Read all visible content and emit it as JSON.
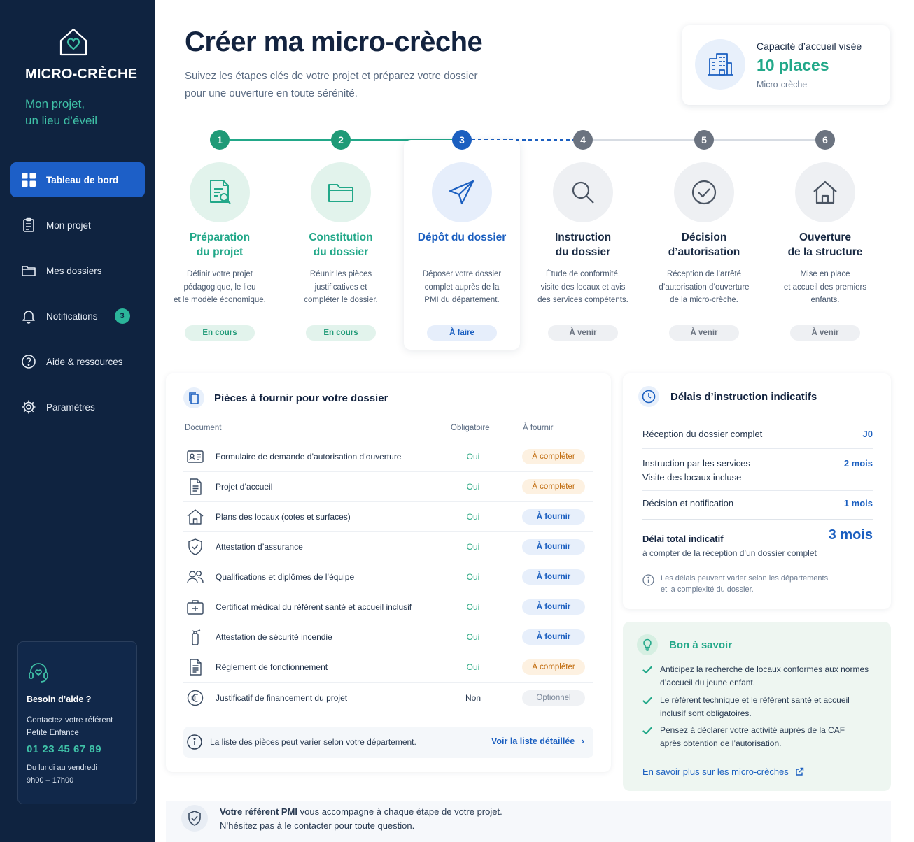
{
  "sidebar": {
    "brand": "MICRO-CRÈCHE",
    "tagline_1": "Mon projet,",
    "tagline_2": "un lieu d’éveil",
    "items": [
      {
        "label": "Tableau de bord",
        "icon": "grid-icon"
      },
      {
        "label": "Mon projet",
        "icon": "clipboard-icon"
      },
      {
        "label": "Mes dossiers",
        "icon": "folder-icon"
      },
      {
        "label": "Notifications",
        "icon": "bell-icon",
        "badge": "3"
      },
      {
        "label": "Aide & ressources",
        "icon": "help-circle-icon"
      },
      {
        "label": "Paramètres",
        "icon": "gear-icon"
      }
    ],
    "help": {
      "title": "Besoin d’aide ?",
      "text": "Contactez votre référent Petite Enfance",
      "phone": "01 23 45 67 89",
      "hours_1": "Du lundi au vendredi",
      "hours_2": "9h00 – 17h00"
    }
  },
  "header": {
    "title": "Créer ma micro-crèche",
    "subtitle_1": "Suivez les étapes clés de votre projet et préparez votre dossier",
    "subtitle_2": "pour une ouverture en toute sérénité."
  },
  "capacity": {
    "label": "Capacité d’accueil visée",
    "value": "10 places",
    "sub": "Micro-crèche"
  },
  "steps": [
    {
      "num": "1",
      "title_1": "Préparation",
      "title_2": "du projet",
      "desc_1": "Définir votre projet",
      "desc_2": "pédagogique, le lieu",
      "desc_3": "et le modèle économique.",
      "status": "En cours",
      "icon": "document-search-icon"
    },
    {
      "num": "2",
      "title_1": "Constitution",
      "title_2": "du dossier",
      "desc_1": "Réunir les pièces",
      "desc_2": "justificatives et",
      "desc_3": "compléter le dossier.",
      "status": "En cours",
      "icon": "folder-icon"
    },
    {
      "num": "3",
      "title_1": "Dépôt du dossier",
      "title_2": "",
      "desc_1": "Déposer votre dossier",
      "desc_2": "complet auprès de la",
      "desc_3": "PMI du département.",
      "status": "À faire",
      "icon": "paper-plane-icon"
    },
    {
      "num": "4",
      "title_1": "Instruction",
      "title_2": "du dossier",
      "desc_1": "Étude de conformité,",
      "desc_2": "visite des locaux et avis",
      "desc_3": "des services compétents.",
      "status": "À venir",
      "icon": "magnifier-icon"
    },
    {
      "num": "5",
      "title_1": "Décision",
      "title_2": "d’autorisation",
      "desc_1": "Réception de l’arrêté",
      "desc_2": "d’autorisation d’ouverture",
      "desc_3": "de la micro-crèche.",
      "status": "À venir",
      "icon": "check-circle-icon"
    },
    {
      "num": "6",
      "title_1": "Ouverture",
      "title_2": "de la structure",
      "desc_1": "Mise en place",
      "desc_2": "et accueil des premiers",
      "desc_3": "enfants.",
      "status": "À venir",
      "icon": "house-icon"
    }
  ],
  "docs": {
    "title": "Pièces à fournir pour votre dossier",
    "col_doc": "Document",
    "col_req": "Obligatoire",
    "col_todo": "À fournir",
    "rows": [
      {
        "name": "Formulaire de demande d’autorisation d’ouverture",
        "req": "Oui",
        "status": "À compléter",
        "icon": "id-card-icon"
      },
      {
        "name": "Projet d’accueil",
        "req": "Oui",
        "status": "À compléter",
        "icon": "document-icon"
      },
      {
        "name": "Plans des locaux (cotes et surfaces)",
        "req": "Oui",
        "status": "À fournir",
        "icon": "house-icon"
      },
      {
        "name": "Attestation d’assurance",
        "req": "Oui",
        "status": "À fournir",
        "icon": "shield-check-icon"
      },
      {
        "name": "Qualifications et diplômes de l’équipe",
        "req": "Oui",
        "status": "À fournir",
        "icon": "users-icon"
      },
      {
        "name": "Certificat médical du référent santé et accueil inclusif",
        "req": "Oui",
        "status": "À fournir",
        "icon": "medical-kit-icon"
      },
      {
        "name": "Attestation de sécurité incendie",
        "req": "Oui",
        "status": "À fournir",
        "icon": "fire-extinguisher-icon"
      },
      {
        "name": "Règlement de fonctionnement",
        "req": "Oui",
        "status": "À compléter",
        "icon": "document-lines-icon"
      },
      {
        "name": "Justificatif de financement du projet",
        "req": "Non",
        "status": "Optionnel",
        "icon": "euro-icon"
      }
    ],
    "footer_text": "La liste des pièces peut varier selon votre département.",
    "footer_link": "Voir la liste détaillée"
  },
  "delays": {
    "title": "Délais d’instruction indicatifs",
    "rows": [
      {
        "label_1": "Réception du dossier complet",
        "label_2": "",
        "value": "J0"
      },
      {
        "label_1": "Instruction par les services",
        "label_2": "Visite des locaux incluse",
        "value": "2 mois"
      },
      {
        "label_1": "Décision et notification",
        "label_2": "",
        "value": "1 mois"
      }
    ],
    "total_label": "Délai total indicatif",
    "total_sub": "à compter de la réception d’un dossier complet",
    "total_value": "3 mois",
    "note_1": "Les délais peuvent varier selon les départements",
    "note_2": "et la complexité du dossier."
  },
  "tips": {
    "title": "Bon à savoir",
    "items": [
      {
        "line_1": "Anticipez la recherche de locaux conformes aux normes",
        "line_2": "d’accueil du jeune enfant."
      },
      {
        "line_1": "Le référent technique et le référent santé et accueil",
        "line_2": "inclusif sont obligatoires."
      },
      {
        "line_1": "Pensez à déclarer votre activité auprès de la CAF",
        "line_2": "après obtention de l’autorisation."
      }
    ],
    "link": "En savoir plus sur les micro-crèches"
  },
  "pmi": {
    "bold": "Votre référent PMI",
    "text": " vous accompagne à chaque étape de votre projet.",
    "line_2": "N’hésitez pas à le contacter pour toute question."
  },
  "colors": {
    "sidebar": "#0f2340",
    "accent_blue": "#1b5fc0",
    "accent_green": "#22a889",
    "upcoming_grey": "#6b7380"
  }
}
